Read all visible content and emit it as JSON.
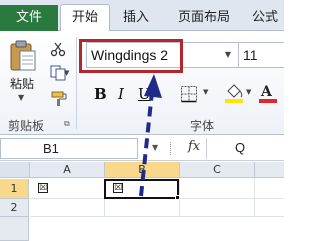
{
  "tabs": {
    "file": "文件",
    "home": "开始",
    "insert": "插入",
    "page_layout": "页面布局",
    "formulas_partial": "公式"
  },
  "clipboard": {
    "paste_label": "粘贴",
    "group_label": "剪贴板"
  },
  "font": {
    "name": "Wingdings 2",
    "size": "11",
    "group_label": "字体",
    "bold": "B",
    "italic": "I",
    "underline": "U"
  },
  "formula_bar": {
    "cell_ref": "B1",
    "fx": "fx",
    "content": "Q"
  },
  "grid": {
    "columns": [
      "A",
      "B",
      "C"
    ],
    "rows": [
      "1",
      "2"
    ],
    "selected_column": "B",
    "selected_row": "1",
    "cells": {
      "A1": "☒",
      "B1": "☒"
    }
  },
  "colors": {
    "file_tab": "#2a7a3f",
    "highlight_box": "#b3262e",
    "arrow": "#1f2a8a",
    "selected_header": "#f8d98c"
  }
}
